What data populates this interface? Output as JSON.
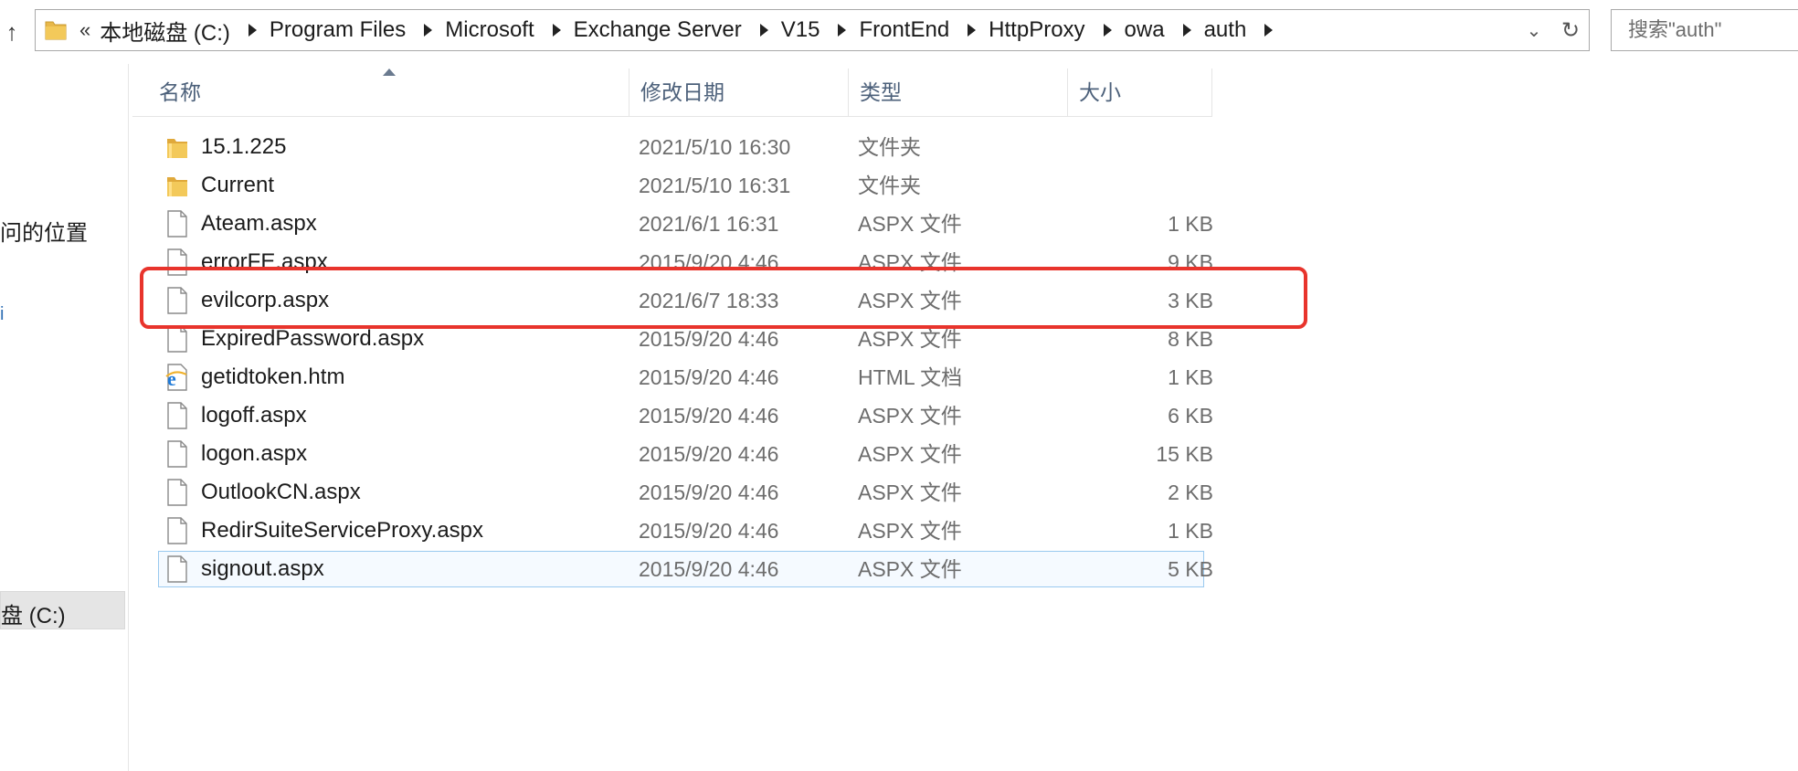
{
  "address": {
    "overflow": "«",
    "crumbs": [
      "本地磁盘 (C:)",
      "Program Files",
      "Microsoft",
      "Exchange Server",
      "V15",
      "FrontEnd",
      "HttpProxy",
      "owa",
      "auth"
    ],
    "dropdown_glyph": "⌄",
    "refresh_glyph": "↻"
  },
  "search": {
    "placeholder": "搜索\"auth\""
  },
  "nav": {
    "item_recent": "问的位置",
    "item_link": "i",
    "item_drive": "盘 (C:)"
  },
  "columns": {
    "name": "名称",
    "date": "修改日期",
    "type": "类型",
    "size": "大小"
  },
  "files": [
    {
      "name": "15.1.225",
      "date": "2021/5/10 16:30",
      "type": "文件夹",
      "size": "",
      "icon": "folder-icon"
    },
    {
      "name": "Current",
      "date": "2021/5/10 16:31",
      "type": "文件夹",
      "size": "",
      "icon": "folder-icon"
    },
    {
      "name": "Ateam.aspx",
      "date": "2021/6/1 16:31",
      "type": "ASPX 文件",
      "size": "1 KB",
      "icon": "file-icon"
    },
    {
      "name": "errorFE.aspx",
      "date": "2015/9/20 4:46",
      "type": "ASPX 文件",
      "size": "9 KB",
      "icon": "file-icon"
    },
    {
      "name": "evilcorp.aspx",
      "date": "2021/6/7 18:33",
      "type": "ASPX 文件",
      "size": "3 KB",
      "icon": "file-icon"
    },
    {
      "name": "ExpiredPassword.aspx",
      "date": "2015/9/20 4:46",
      "type": "ASPX 文件",
      "size": "8 KB",
      "icon": "file-icon"
    },
    {
      "name": "getidtoken.htm",
      "date": "2015/9/20 4:46",
      "type": "HTML 文档",
      "size": "1 KB",
      "icon": "ie-icon"
    },
    {
      "name": "logoff.aspx",
      "date": "2015/9/20 4:46",
      "type": "ASPX 文件",
      "size": "6 KB",
      "icon": "file-icon"
    },
    {
      "name": "logon.aspx",
      "date": "2015/9/20 4:46",
      "type": "ASPX 文件",
      "size": "15 KB",
      "icon": "file-icon"
    },
    {
      "name": "OutlookCN.aspx",
      "date": "2015/9/20 4:46",
      "type": "ASPX 文件",
      "size": "2 KB",
      "icon": "file-icon"
    },
    {
      "name": "RedirSuiteServiceProxy.aspx",
      "date": "2015/9/20 4:46",
      "type": "ASPX 文件",
      "size": "1 KB",
      "icon": "file-icon"
    },
    {
      "name": "signout.aspx",
      "date": "2015/9/20 4:46",
      "type": "ASPX 文件",
      "size": "5 KB",
      "icon": "file-icon"
    }
  ],
  "selected_index": 11,
  "highlighted_index": 4,
  "colors": {
    "highlight": "#e8342c",
    "selection_border": "#99c9ef",
    "folder": "#e8b84a"
  }
}
